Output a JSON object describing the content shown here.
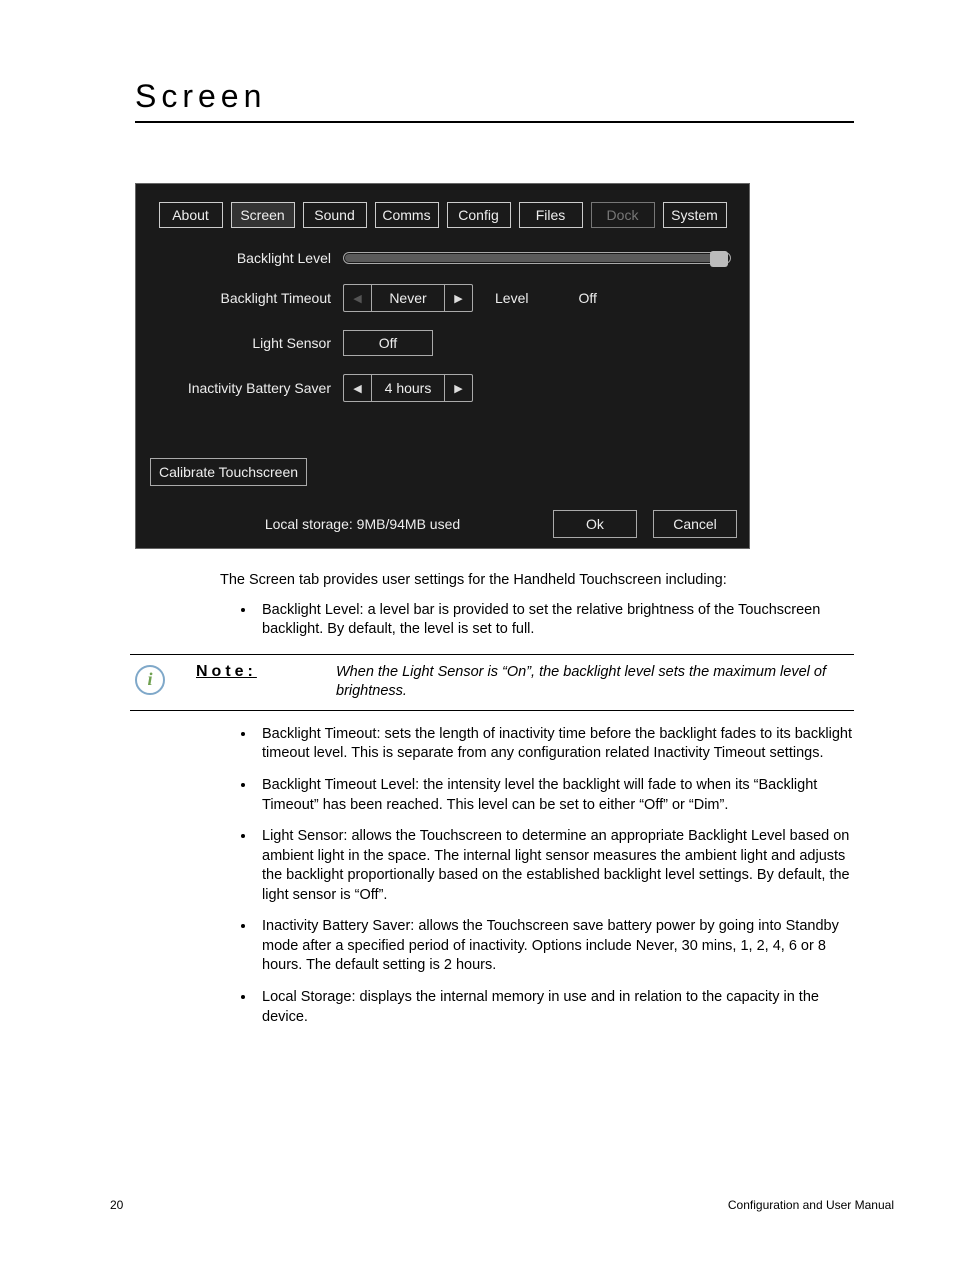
{
  "heading": "Screen",
  "tabs": [
    "About",
    "Screen",
    "Sound",
    "Comms",
    "Config",
    "Files",
    "Dock",
    "System"
  ],
  "active_tab_index": 1,
  "disabled_tab_index": 6,
  "settings": {
    "backlight_level_label": "Backlight Level",
    "backlight_timeout_label": "Backlight Timeout",
    "backlight_timeout_value": "Never",
    "timeout_level_label": "Level",
    "timeout_level_value": "Off",
    "light_sensor_label": "Light Sensor",
    "light_sensor_value": "Off",
    "battery_saver_label": "Inactivity Battery Saver",
    "battery_saver_value": "4 hours",
    "calibrate_button": "Calibrate Touchscreen",
    "storage_text": "Local storage: 9MB/94MB used",
    "ok_button": "Ok",
    "cancel_button": "Cancel"
  },
  "intro_text": "The Screen tab provides user settings for the Handheld Touchscreen including:",
  "bullet1": "Backlight Level: a level bar is provided to set the relative brightness of the Touchscreen backlight. By default, the level is set to full.",
  "note_label": "Note:",
  "note_text": "When the Light Sensor is “On”, the backlight level sets the maximum level of brightness.",
  "bullets_after": [
    "Backlight Timeout: sets the length of inactivity time before the backlight fades to its backlight timeout level. This is separate from any configuration related Inactivity Timeout settings.",
    "Backlight Timeout Level: the intensity level the backlight will fade to when its “Backlight Timeout” has been reached. This level can be set to either “Off” or “Dim”.",
    "Light Sensor: allows the Touchscreen to determine an appropriate Backlight Level based on ambient light in the space. The internal light sensor measures the ambient light and adjusts the backlight proportionally based on the established backlight level settings. By default, the light sensor is “Off”.",
    "Inactivity Battery Saver: allows the Touchscreen save battery power by going into Standby mode after a specified period of inactivity. Options include Never, 30 mins, 1, 2, 4, 6 or 8 hours. The default setting is 2 hours.",
    "Local Storage: displays the internal memory in use and in relation to the capacity in the device."
  ],
  "footer": {
    "page_number": "20",
    "doc_title": "Configuration and User Manual"
  }
}
